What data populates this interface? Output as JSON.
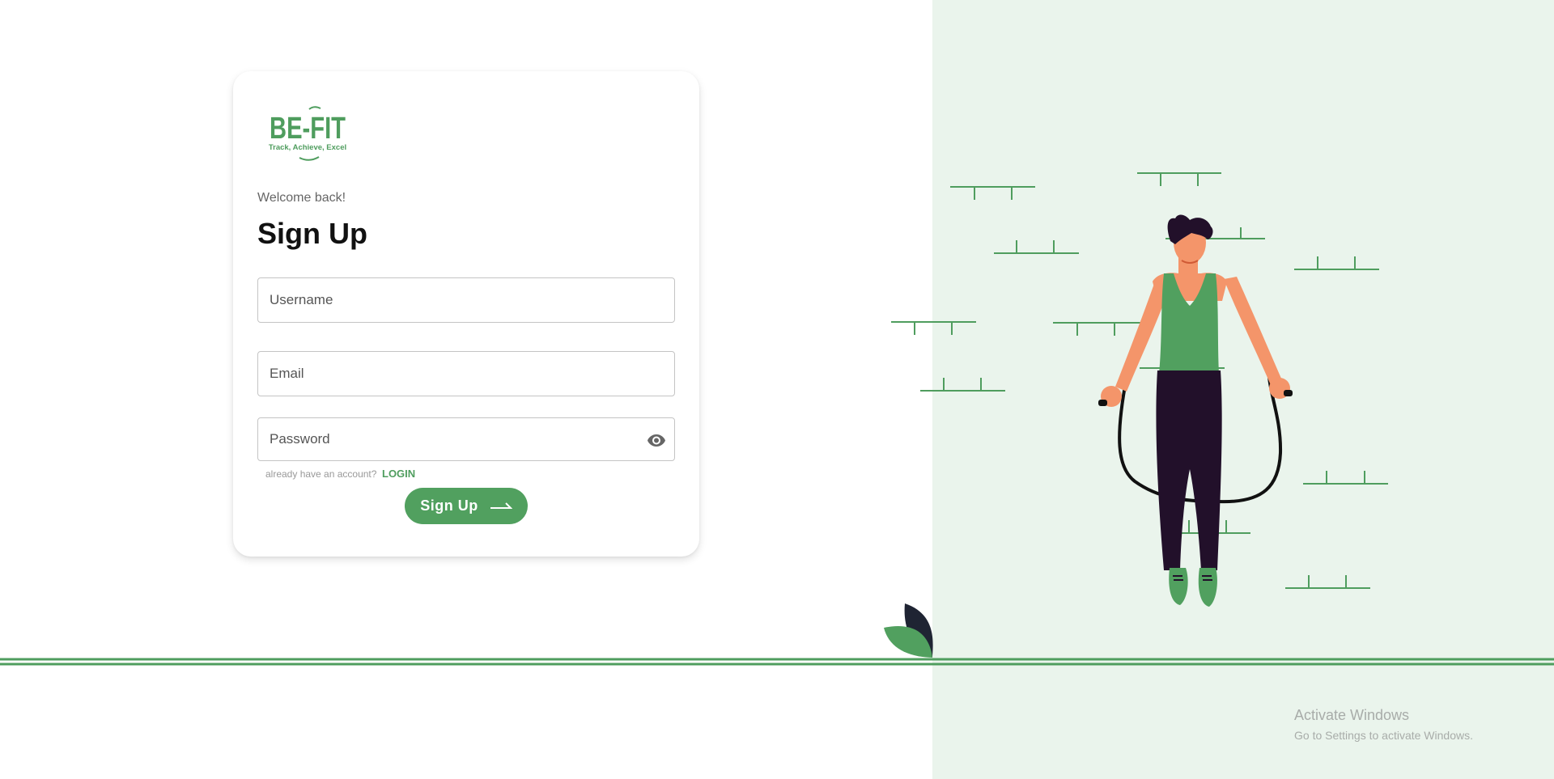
{
  "logo": {
    "brand": "BE-FIT",
    "tagline": "Track, Achieve, Excel"
  },
  "form": {
    "welcome": "Welcome back!",
    "title": "Sign Up",
    "username_placeholder": "Username",
    "email_placeholder": "Email",
    "password_placeholder": "Password",
    "account_text": "already have an account?",
    "login_label": "LOGIN",
    "signup_label": "Sign Up"
  },
  "watermark": {
    "title": "Activate Windows",
    "subtitle": "Go to Settings to activate Windows."
  },
  "icons": {
    "password_toggle": "eye-icon",
    "signup_arrow": "arrow-right-icon"
  },
  "colors": {
    "brand_green": "#4f9d5e",
    "panel_bg": "#eaf4ec",
    "pants": "#22102a",
    "skin": "#f4956a"
  }
}
